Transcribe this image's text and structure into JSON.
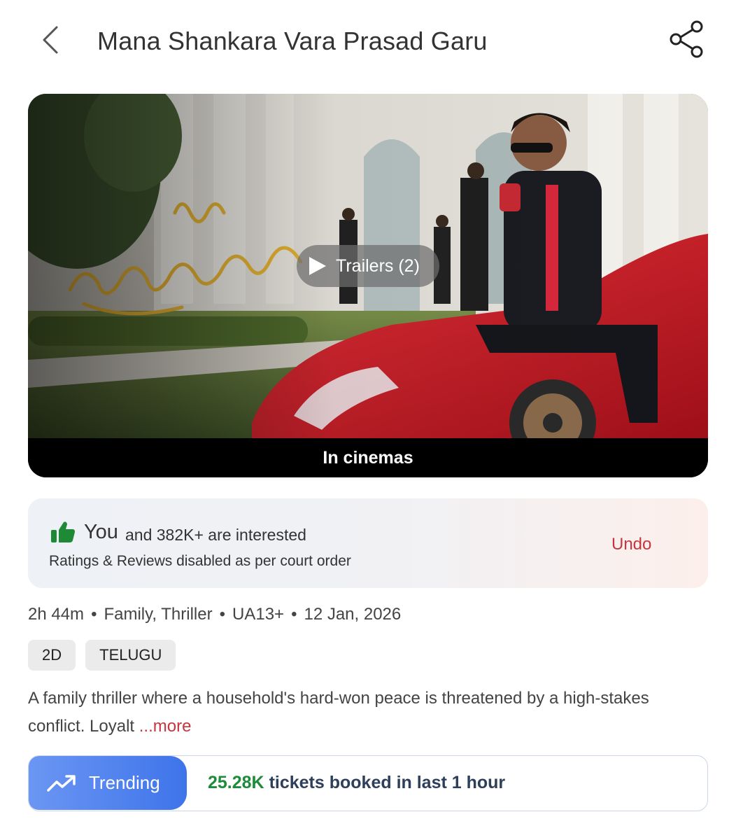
{
  "header": {
    "title": "Mana Shankara Vara Prasad Garu",
    "back_icon": "chevron-left-icon",
    "share_icon": "share-icon"
  },
  "hero": {
    "trailers_label": "Trailers (2)",
    "status_label": "In cinemas"
  },
  "interest": {
    "you_label": "You",
    "count_text": "and 382K+  are interested",
    "note": "Ratings & Reviews disabled as per court order",
    "undo_label": "Undo",
    "icon": "thumbs-up-icon",
    "icon_color": "#1f8a35",
    "undo_color": "#c8343f"
  },
  "meta": {
    "duration": "2h 44m",
    "genres": "Family, Thriller",
    "certificate": "UA13+",
    "release_date": "12 Jan, 2026",
    "separator": "•"
  },
  "tags": [
    "2D",
    "TELUGU"
  ],
  "description": {
    "text": "A family thriller where a household's hard-won peace is threatened by a high-stakes conflict. Loyalt ",
    "more_label": "...more"
  },
  "trending": {
    "label": "Trending",
    "icon": "trending-up-icon",
    "count": "25.28K",
    "text": " tickets booked in last 1 hour",
    "accent": "#3e74ea",
    "count_color": "#1e8b3a"
  }
}
